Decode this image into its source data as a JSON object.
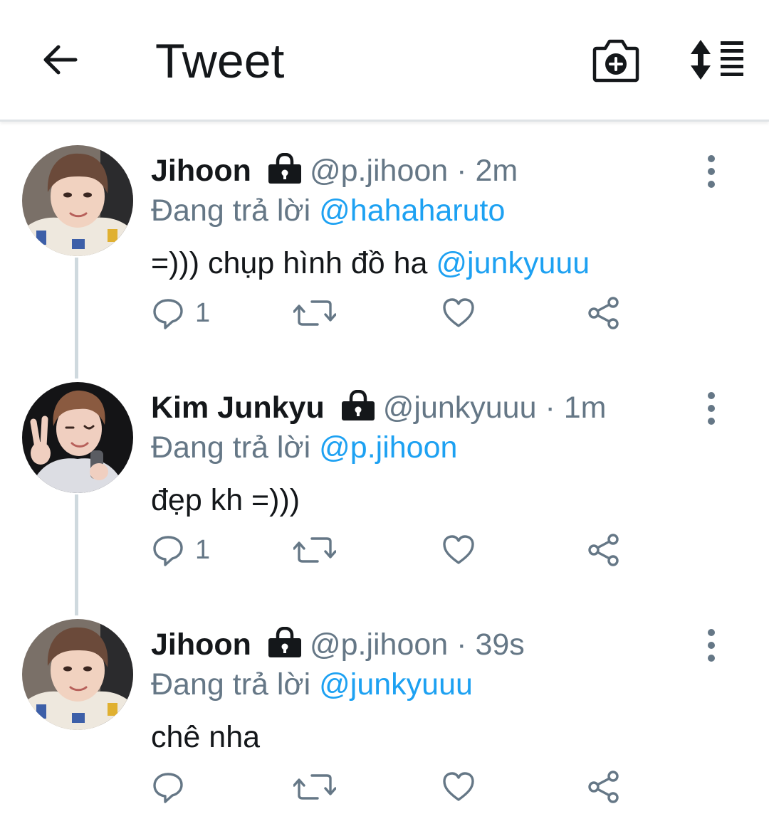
{
  "header": {
    "title": "Tweet",
    "back_icon": "arrow-left-icon",
    "camera_icon": "camera-plus-icon",
    "sort_icon": "sort-thread-icon"
  },
  "colors": {
    "link": "#1da1f2",
    "secondary": "#657786",
    "text": "#14171a"
  },
  "tweets": [
    {
      "name": "Jihoon",
      "handle": "@p.jihoon",
      "time": "· 2m",
      "reply_prefix": "Đang trả lời",
      "reply_to": "@hahaharuto",
      "text": "=))) chụp hình đồ ha",
      "text_mention": "@junkyuuu",
      "reply_count": "1"
    },
    {
      "name": "Kim Junkyu",
      "handle": "@junkyuuu",
      "time": "· 1m",
      "reply_prefix": "Đang trả lời",
      "reply_to": "@p.jihoon",
      "text": "đẹp kh =)))",
      "text_mention": "",
      "reply_count": "1"
    },
    {
      "name": "Jihoon",
      "handle": "@p.jihoon",
      "time": "· 39s",
      "reply_prefix": "Đang trả lời",
      "reply_to": "@junkyuuu",
      "text": "chê nha",
      "text_mention": "",
      "reply_count": ""
    }
  ]
}
